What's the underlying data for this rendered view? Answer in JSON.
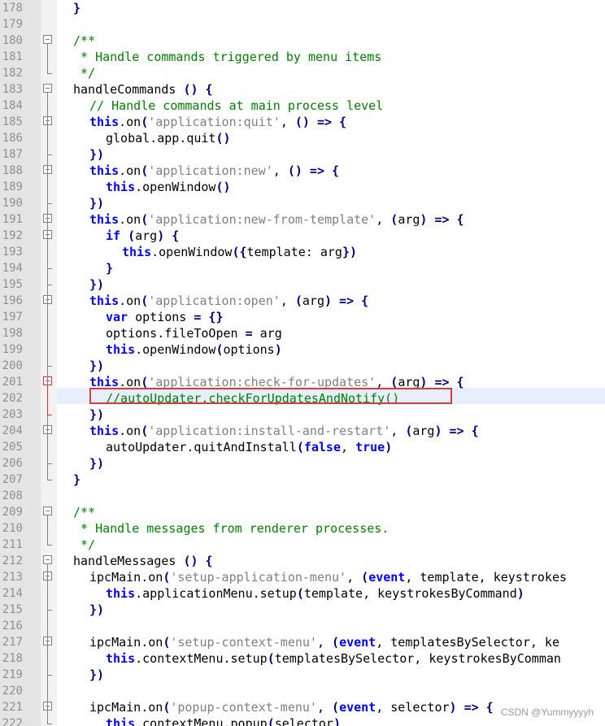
{
  "editor": {
    "first_line_number": 178,
    "highlighted_line_number": 202,
    "lines": [
      {
        "n": "178",
        "indent": 0,
        "fold": "",
        "t": [
          [
            "p",
            "}"
          ]
        ]
      },
      {
        "n": "179",
        "indent": 0,
        "fold": "",
        "t": []
      },
      {
        "n": "180",
        "indent": 0,
        "fold": "open",
        "t": [
          [
            "c",
            "/**"
          ]
        ]
      },
      {
        "n": "181",
        "indent": 0,
        "fold": "",
        "t": [
          [
            "c",
            " * Handle commands triggered by menu items"
          ]
        ]
      },
      {
        "n": "182",
        "indent": 0,
        "fold": "",
        "t": [
          [
            "c",
            " */"
          ]
        ]
      },
      {
        "n": "183",
        "indent": 0,
        "fold": "open",
        "t": [
          [
            "i",
            "handleCommands "
          ],
          [
            "p",
            "() {"
          ]
        ]
      },
      {
        "n": "184",
        "indent": 1,
        "fold": "",
        "t": [
          [
            "c",
            "// Handle commands at main process level"
          ]
        ]
      },
      {
        "n": "185",
        "indent": 1,
        "fold": "open",
        "t": [
          [
            "k",
            "this"
          ],
          [
            "i",
            "."
          ],
          [
            "i",
            "on"
          ],
          [
            "p",
            "("
          ],
          [
            "s",
            "'application:quit'"
          ],
          [
            "i",
            ", "
          ],
          [
            "p",
            "() => {"
          ]
        ]
      },
      {
        "n": "186",
        "indent": 2,
        "fold": "",
        "t": [
          [
            "i",
            "global.app.quit"
          ],
          [
            "p",
            "()"
          ]
        ]
      },
      {
        "n": "187",
        "indent": 1,
        "fold": "",
        "t": [
          [
            "p",
            "})"
          ]
        ]
      },
      {
        "n": "188",
        "indent": 1,
        "fold": "open",
        "t": [
          [
            "k",
            "this"
          ],
          [
            "i",
            ".on"
          ],
          [
            "p",
            "("
          ],
          [
            "s",
            "'application:new'"
          ],
          [
            "i",
            ", "
          ],
          [
            "p",
            "() => {"
          ]
        ]
      },
      {
        "n": "189",
        "indent": 2,
        "fold": "",
        "t": [
          [
            "k",
            "this"
          ],
          [
            "i",
            ".openWindow"
          ],
          [
            "p",
            "()"
          ]
        ]
      },
      {
        "n": "190",
        "indent": 1,
        "fold": "",
        "t": [
          [
            "p",
            "})"
          ]
        ]
      },
      {
        "n": "191",
        "indent": 1,
        "fold": "open",
        "t": [
          [
            "k",
            "this"
          ],
          [
            "i",
            ".on"
          ],
          [
            "p",
            "("
          ],
          [
            "s",
            "'application:new-from-template'"
          ],
          [
            "i",
            ", "
          ],
          [
            "p",
            "("
          ],
          [
            "i",
            "arg"
          ],
          [
            "p",
            ") => {"
          ]
        ]
      },
      {
        "n": "192",
        "indent": 2,
        "fold": "open",
        "t": [
          [
            "k",
            "if"
          ],
          [
            "i",
            " "
          ],
          [
            "p",
            "("
          ],
          [
            "i",
            "arg"
          ],
          [
            "p",
            ") {"
          ]
        ]
      },
      {
        "n": "193",
        "indent": 3,
        "fold": "",
        "t": [
          [
            "k",
            "this"
          ],
          [
            "i",
            ".openWindow"
          ],
          [
            "p",
            "({"
          ],
          [
            "i",
            "template: arg"
          ],
          [
            "p",
            "})"
          ]
        ]
      },
      {
        "n": "194",
        "indent": 2,
        "fold": "",
        "t": [
          [
            "p",
            "}"
          ]
        ]
      },
      {
        "n": "195",
        "indent": 1,
        "fold": "",
        "t": [
          [
            "p",
            "})"
          ]
        ]
      },
      {
        "n": "196",
        "indent": 1,
        "fold": "open",
        "t": [
          [
            "k",
            "this"
          ],
          [
            "i",
            ".on"
          ],
          [
            "p",
            "("
          ],
          [
            "s",
            "'application:open'"
          ],
          [
            "i",
            ", "
          ],
          [
            "p",
            "("
          ],
          [
            "i",
            "arg"
          ],
          [
            "p",
            ") => {"
          ]
        ]
      },
      {
        "n": "197",
        "indent": 2,
        "fold": "",
        "t": [
          [
            "k",
            "var"
          ],
          [
            "i",
            " options "
          ],
          [
            "p",
            "= {}"
          ]
        ]
      },
      {
        "n": "198",
        "indent": 2,
        "fold": "",
        "t": [
          [
            "i",
            "options.fileToOpen "
          ],
          [
            "p",
            "="
          ],
          [
            "i",
            " arg"
          ]
        ]
      },
      {
        "n": "199",
        "indent": 2,
        "fold": "",
        "t": [
          [
            "k",
            "this"
          ],
          [
            "i",
            ".openWindow"
          ],
          [
            "p",
            "("
          ],
          [
            "i",
            "options"
          ],
          [
            "p",
            ")"
          ]
        ]
      },
      {
        "n": "200",
        "indent": 1,
        "fold": "",
        "t": [
          [
            "p",
            "})"
          ]
        ]
      },
      {
        "n": "201",
        "indent": 1,
        "fold": "red",
        "t": [
          [
            "k",
            "this"
          ],
          [
            "i",
            ".on"
          ],
          [
            "p",
            "("
          ],
          [
            "s",
            "'application:check-for-updates'"
          ],
          [
            "i",
            ", "
          ],
          [
            "p",
            "("
          ],
          [
            "i",
            "arg"
          ],
          [
            "p",
            ") => {"
          ]
        ]
      },
      {
        "n": "202",
        "indent": 2,
        "fold": "",
        "t": [
          [
            "c",
            "//autoUpdater.checkForUpdatesAndNotify()"
          ]
        ]
      },
      {
        "n": "203",
        "indent": 1,
        "fold": "",
        "t": [
          [
            "p",
            "})"
          ]
        ]
      },
      {
        "n": "204",
        "indent": 1,
        "fold": "open",
        "t": [
          [
            "k",
            "this"
          ],
          [
            "i",
            ".on"
          ],
          [
            "p",
            "("
          ],
          [
            "s",
            "'application:install-and-restart'"
          ],
          [
            "i",
            ", "
          ],
          [
            "p",
            "("
          ],
          [
            "i",
            "arg"
          ],
          [
            "p",
            ") => {"
          ]
        ]
      },
      {
        "n": "205",
        "indent": 2,
        "fold": "",
        "t": [
          [
            "i",
            "autoUpdater.quitAndInstall"
          ],
          [
            "p",
            "("
          ],
          [
            "k",
            "false"
          ],
          [
            "i",
            ", "
          ],
          [
            "k",
            "true"
          ],
          [
            "p",
            ")"
          ]
        ]
      },
      {
        "n": "206",
        "indent": 1,
        "fold": "",
        "t": [
          [
            "p",
            "})"
          ]
        ]
      },
      {
        "n": "207",
        "indent": 0,
        "fold": "",
        "t": [
          [
            "p",
            "}"
          ]
        ]
      },
      {
        "n": "208",
        "indent": 0,
        "fold": "",
        "t": []
      },
      {
        "n": "209",
        "indent": 0,
        "fold": "open",
        "t": [
          [
            "c",
            "/**"
          ]
        ]
      },
      {
        "n": "210",
        "indent": 0,
        "fold": "",
        "t": [
          [
            "c",
            " * Handle messages from renderer processes."
          ]
        ]
      },
      {
        "n": "211",
        "indent": 0,
        "fold": "",
        "t": [
          [
            "c",
            " */"
          ]
        ]
      },
      {
        "n": "212",
        "indent": 0,
        "fold": "open",
        "t": [
          [
            "i",
            "handleMessages "
          ],
          [
            "p",
            "() {"
          ]
        ]
      },
      {
        "n": "213",
        "indent": 1,
        "fold": "open",
        "t": [
          [
            "i",
            "ipcMain.on"
          ],
          [
            "p",
            "("
          ],
          [
            "s",
            "'setup-application-menu'"
          ],
          [
            "i",
            ", "
          ],
          [
            "p",
            "("
          ],
          [
            "k",
            "event"
          ],
          [
            "i",
            ", template, keystrokes"
          ]
        ]
      },
      {
        "n": "214",
        "indent": 2,
        "fold": "",
        "t": [
          [
            "k",
            "this"
          ],
          [
            "i",
            ".applicationMenu.setup"
          ],
          [
            "p",
            "("
          ],
          [
            "i",
            "template, keystrokesByCommand"
          ],
          [
            "p",
            ")"
          ]
        ]
      },
      {
        "n": "215",
        "indent": 1,
        "fold": "",
        "t": [
          [
            "p",
            "})"
          ]
        ]
      },
      {
        "n": "216",
        "indent": 0,
        "fold": "",
        "t": []
      },
      {
        "n": "217",
        "indent": 1,
        "fold": "open",
        "t": [
          [
            "i",
            "ipcMain.on"
          ],
          [
            "p",
            "("
          ],
          [
            "s",
            "'setup-context-menu'"
          ],
          [
            "i",
            ", "
          ],
          [
            "p",
            "("
          ],
          [
            "k",
            "event"
          ],
          [
            "i",
            ", templatesBySelector, ke"
          ]
        ]
      },
      {
        "n": "218",
        "indent": 2,
        "fold": "",
        "t": [
          [
            "k",
            "this"
          ],
          [
            "i",
            ".contextMenu.setup"
          ],
          [
            "p",
            "("
          ],
          [
            "i",
            "templatesBySelector, keystrokesByComman"
          ]
        ]
      },
      {
        "n": "219",
        "indent": 1,
        "fold": "",
        "t": [
          [
            "p",
            "})"
          ]
        ]
      },
      {
        "n": "220",
        "indent": 0,
        "fold": "",
        "t": []
      },
      {
        "n": "221",
        "indent": 1,
        "fold": "open",
        "t": [
          [
            "i",
            "ipcMain.on"
          ],
          [
            "p",
            "("
          ],
          [
            "s",
            "'popup-context-menu'"
          ],
          [
            "i",
            ", "
          ],
          [
            "p",
            "("
          ],
          [
            "k",
            "event"
          ],
          [
            "i",
            ", selector"
          ],
          [
            "p",
            ") => {"
          ]
        ]
      },
      {
        "n": "222",
        "indent": 2,
        "fold": "",
        "t": [
          [
            "k",
            "this"
          ],
          [
            "i",
            ".contextMenu.popup"
          ],
          [
            "p",
            "("
          ],
          [
            "i",
            "selector"
          ],
          [
            "p",
            ")"
          ]
        ]
      }
    ]
  },
  "watermark": "CSDN @Yummyyyyh",
  "colors": {
    "keyword": "#0000ff",
    "string": "#808080",
    "comment": "#008000",
    "identifier": "#000000",
    "punct": "#000080",
    "annotation": "#e0393c"
  }
}
